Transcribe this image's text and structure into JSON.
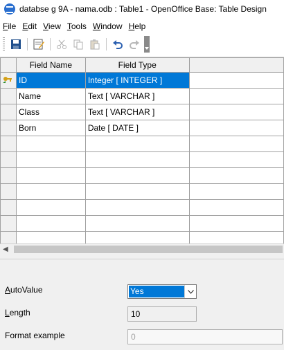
{
  "window": {
    "title": "databse g 9A - nama.odb : Table1 - OpenOffice Base: Table Design",
    "app_icon": "openoffice-base-icon"
  },
  "menubar": {
    "items": [
      {
        "label": "File",
        "accel": "F",
        "rest": "ile"
      },
      {
        "label": "Edit",
        "accel": "E",
        "rest": "dit"
      },
      {
        "label": "View",
        "accel": "V",
        "rest": "iew"
      },
      {
        "label": "Tools",
        "accel": "T",
        "rest": "ools"
      },
      {
        "label": "Window",
        "accel": "W",
        "rest": "indow"
      },
      {
        "label": "Help",
        "accel": "H",
        "rest": "elp"
      }
    ]
  },
  "toolbar": {
    "buttons": [
      "save-icon",
      "edit-mode-icon",
      "cut-icon",
      "copy-icon",
      "paste-icon",
      "undo-icon",
      "redo-icon"
    ]
  },
  "grid": {
    "headers": {
      "field_name": "Field Name",
      "field_type": "Field Type",
      "description": ""
    },
    "rows": [
      {
        "name": "ID",
        "type": "Integer [ INTEGER ]",
        "primary_key": true,
        "selected": true
      },
      {
        "name": "Name",
        "type": "Text [ VARCHAR ]"
      },
      {
        "name": "Class",
        "type": "Text [ VARCHAR ]"
      },
      {
        "name": "Born",
        "type": "Date [ DATE ]"
      },
      {
        "name": "",
        "type": ""
      },
      {
        "name": "",
        "type": ""
      },
      {
        "name": "",
        "type": ""
      },
      {
        "name": "",
        "type": ""
      },
      {
        "name": "",
        "type": ""
      },
      {
        "name": "",
        "type": ""
      },
      {
        "name": "",
        "type": ""
      }
    ]
  },
  "properties": {
    "autovalue": {
      "label_accel": "A",
      "label_rest": "utoValue",
      "value": "Yes"
    },
    "length": {
      "label_accel": "L",
      "label_rest": "ength",
      "value": "10"
    },
    "format_example": {
      "label": "Format example",
      "value": "0"
    }
  },
  "colors": {
    "selection": "#0078d7",
    "panel": "#f0f0f0"
  }
}
